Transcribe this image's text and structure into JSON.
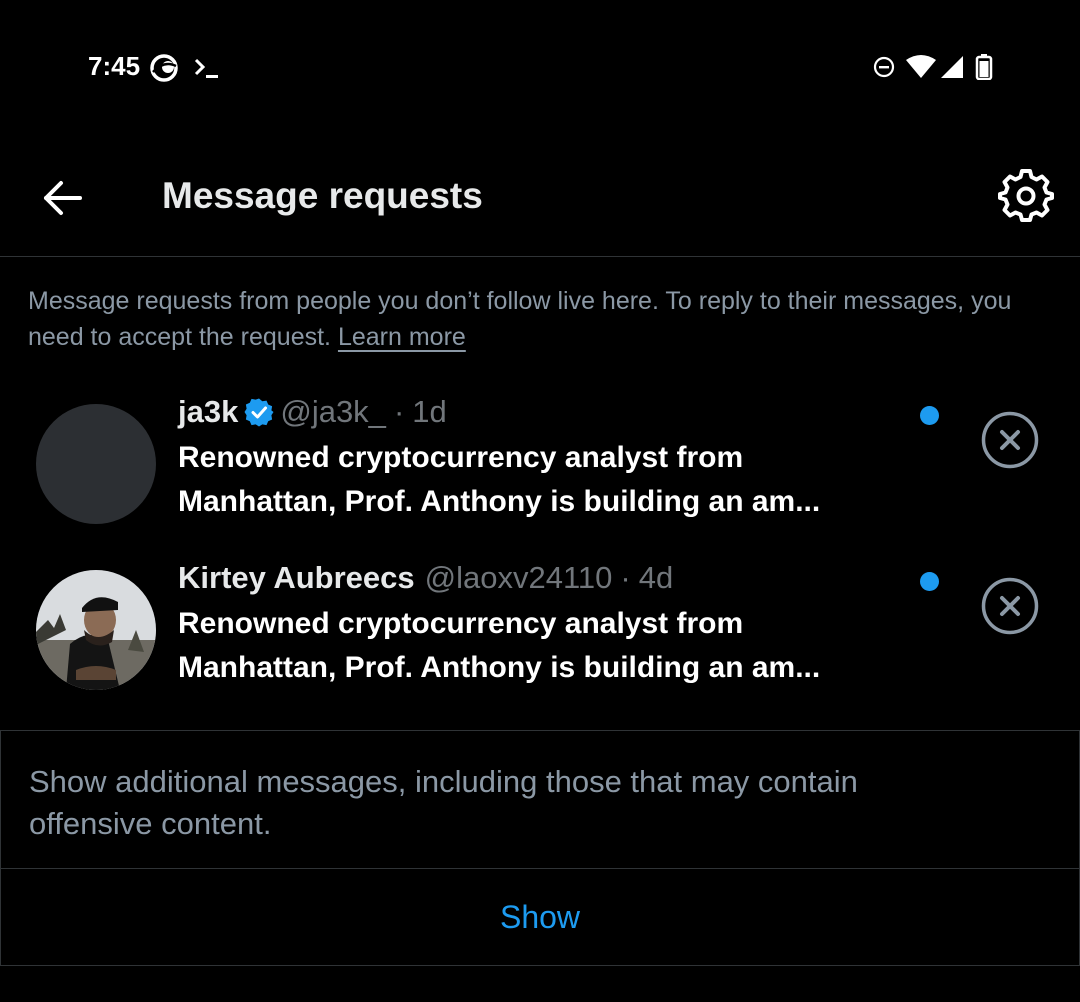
{
  "status_bar": {
    "time": "7:45",
    "left_icons": [
      "app-notification-icon",
      "terminal-icon"
    ],
    "right_icons": [
      "do-not-disturb-icon",
      "wifi-icon",
      "cellular-signal-icon",
      "battery-icon"
    ]
  },
  "header": {
    "title": "Message requests",
    "back_icon": "arrow-left-icon",
    "settings_icon": "gear-icon"
  },
  "info": {
    "text": "Message requests from people you don’t follow live here. To reply to their messages, you need to accept the request.",
    "link": "Learn more"
  },
  "conversations": [
    {
      "display_name": "ja3k",
      "verified": true,
      "handle": "@ja3k_",
      "separator": "·",
      "time": "1d",
      "preview": "Renowned cryptocurrency analyst from Manhattan, Prof. Anthony is building an am...",
      "unread": true
    },
    {
      "display_name": "Kirtey Aubreecs",
      "verified": false,
      "handle": "@laoxv24110",
      "separator": "·",
      "time": "4d",
      "preview": "Renowned cryptocurrency analyst from Manhattan, Prof. Anthony is building an am...",
      "unread": true
    }
  ],
  "filter_panel": {
    "text": "Show additional messages, including those that may contain offensive content.",
    "button_label": "Show"
  },
  "colors": {
    "background": "#000000",
    "accent": "#1d9bf0",
    "secondary_text": "#8b98a5",
    "divider": "#2f3336"
  }
}
